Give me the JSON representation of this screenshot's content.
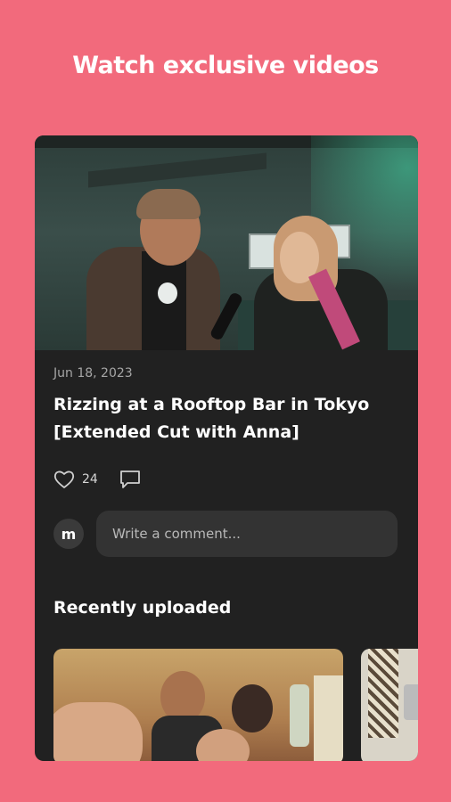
{
  "headline": "Watch exclusive videos",
  "post": {
    "date": "Jun 18, 2023",
    "title": "Rizzing at a Rooftop Bar in Tokyo [Extended Cut with Anna]",
    "like_count": "24",
    "avatar_letter": "m",
    "comment_placeholder": "Write a comment..."
  },
  "recent": {
    "heading": "Recently uploaded"
  },
  "icons": {
    "like": "heart-icon",
    "comment": "comment-icon"
  },
  "colors": {
    "background": "#f26a7c",
    "card": "#212121",
    "input": "#333333"
  }
}
